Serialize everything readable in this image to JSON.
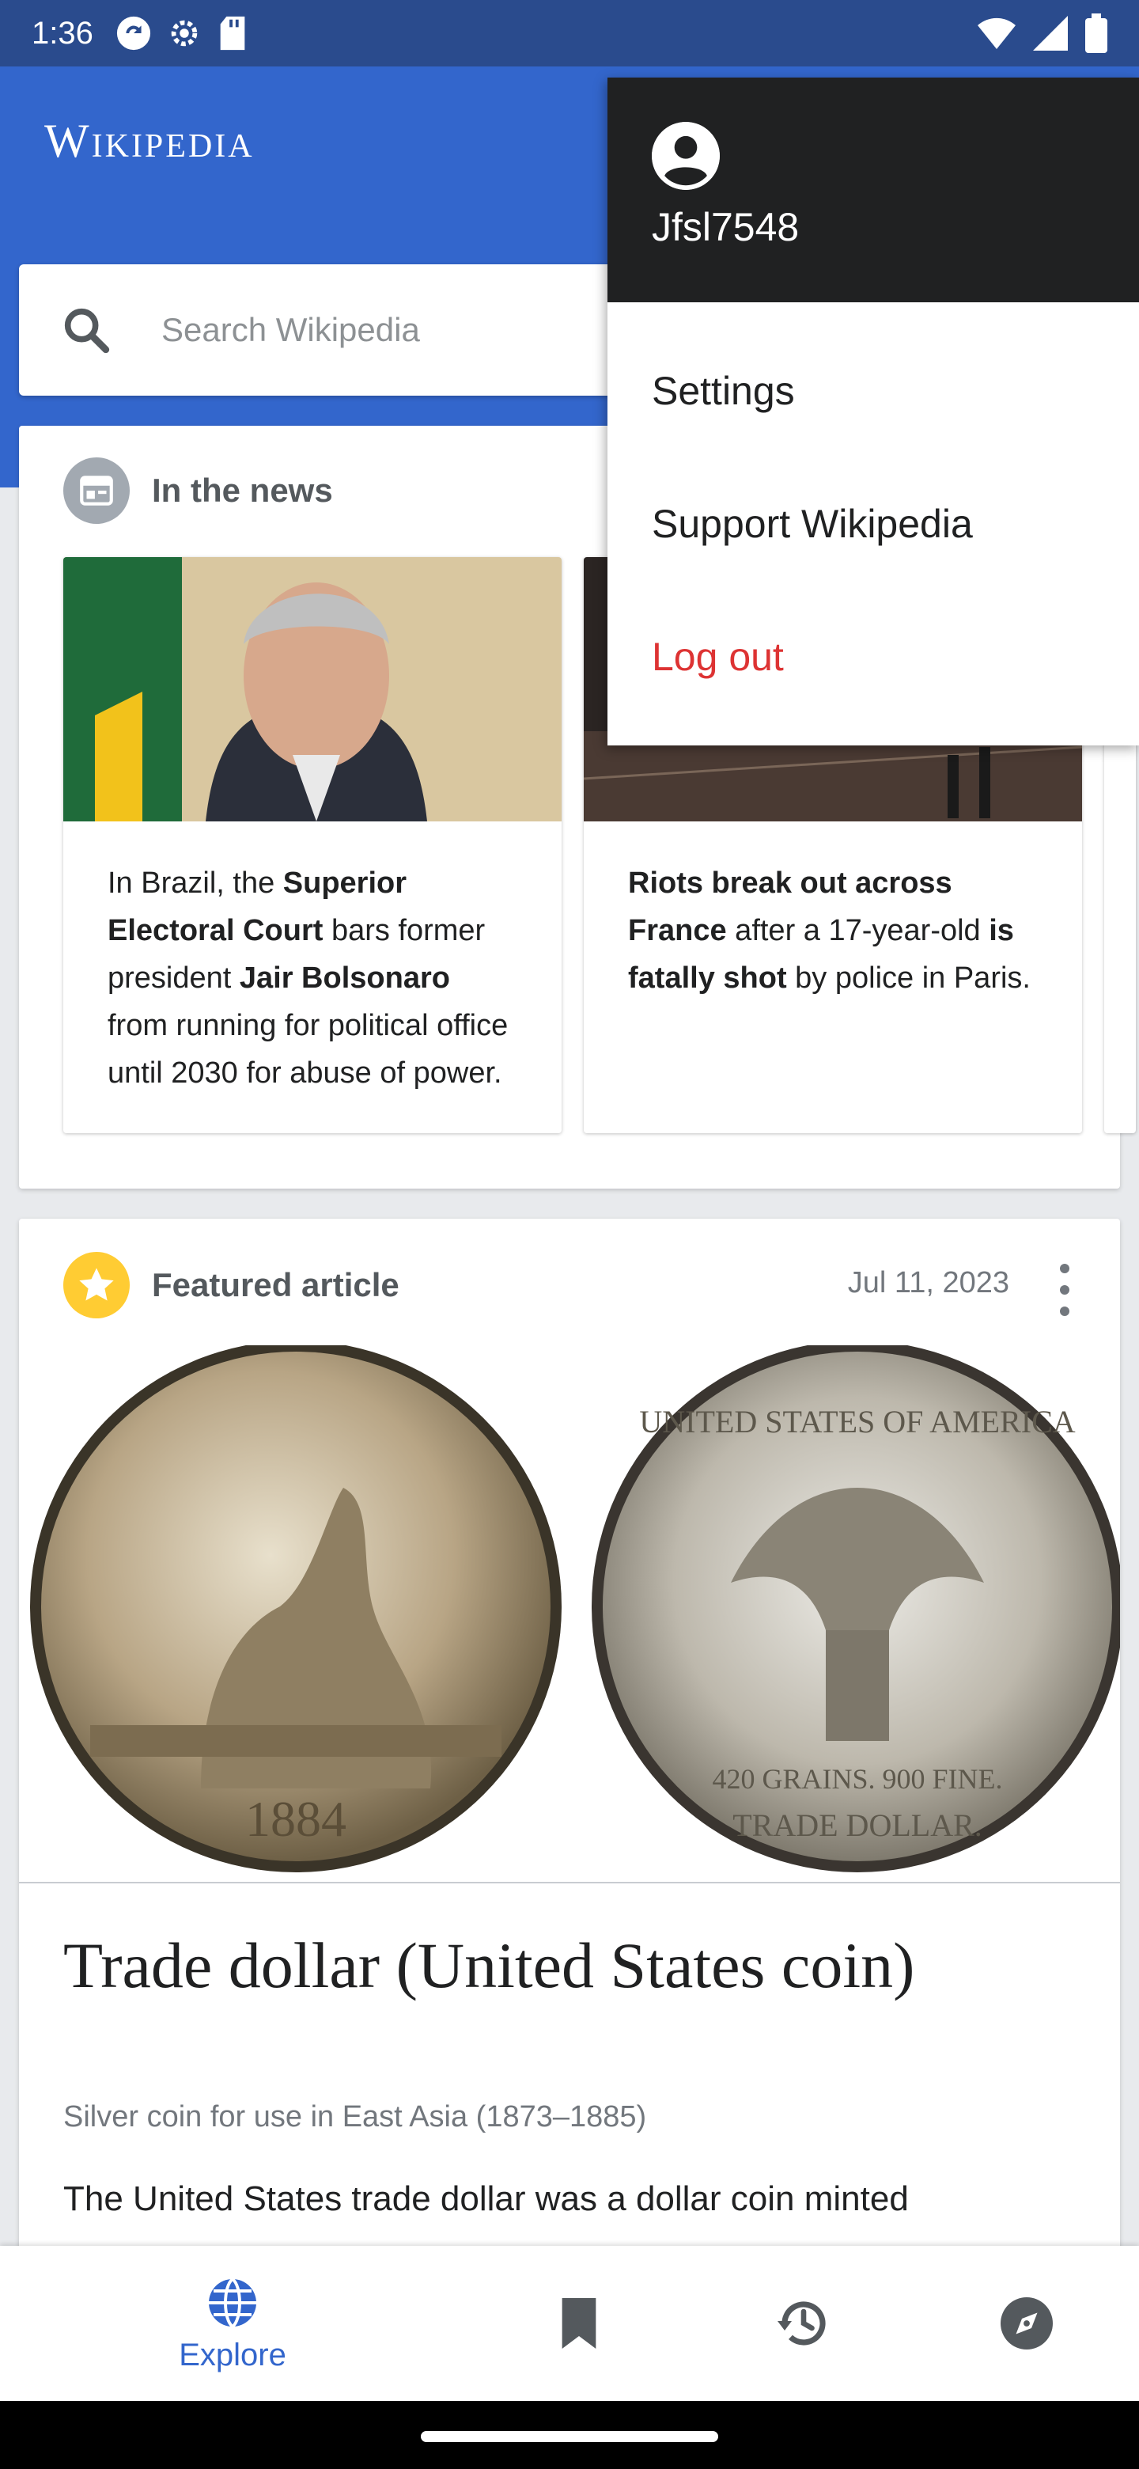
{
  "status_bar": {
    "time": "1:36",
    "icons_left": [
      "sync-icon",
      "settings-icon",
      "sd-card-icon"
    ],
    "icons_right": [
      "wifi-icon",
      "signal-icon",
      "battery-icon"
    ]
  },
  "app_bar": {
    "wordmark": "Wikipedia"
  },
  "search": {
    "placeholder": "Search Wikipedia"
  },
  "in_the_news": {
    "title": "In the news",
    "items": [
      {
        "text_parts": [
          {
            "t": "In Brazil, the ",
            "b": false
          },
          {
            "t": "Superior Electoral Court",
            "b": true
          },
          {
            "t": " bars former president ",
            "b": false
          },
          {
            "t": "Jair Bolsonaro",
            "b": true
          },
          {
            "t": " from running for political office until 2030 for abuse of power.",
            "b": false
          }
        ]
      },
      {
        "text_parts": [
          {
            "t": "Riots break out across France",
            "b": true
          },
          {
            "t": " after a 17-year-old ",
            "b": false
          },
          {
            "t": "is fatally shot",
            "b": true
          },
          {
            "t": " by police in Paris.",
            "b": false
          }
        ]
      }
    ]
  },
  "featured_article": {
    "header": "Featured article",
    "date": "Jul 11, 2023",
    "title": "Trade dollar (United States coin)",
    "subtitle": "Silver coin for use in East Asia (1873–1885)",
    "extract": "The United States trade dollar was a dollar coin minted",
    "coin_obverse_year": "1884",
    "coin_reverse_lines": [
      "UNITED STATES OF AMERICA",
      "420 GRAINS. 900 FINE.",
      "TRADE DOLLAR."
    ]
  },
  "bottom_nav": {
    "items": [
      {
        "label": "Explore",
        "icon": "globe-icon",
        "active": true
      },
      {
        "label": "",
        "icon": "bookmark-icon",
        "active": false
      },
      {
        "label": "",
        "icon": "history-icon",
        "active": false
      },
      {
        "label": "",
        "icon": "compass-icon",
        "active": false
      }
    ]
  },
  "overflow_menu": {
    "username": "Jfsl7548",
    "items": [
      {
        "label": "Settings"
      },
      {
        "label": "Support Wikipedia"
      },
      {
        "label": "Log out"
      }
    ]
  },
  "colors": {
    "app_bar": "#3366cc",
    "status_bar": "#2a4b8d",
    "menu_header": "#202122",
    "logout": "#dd3333",
    "featured_star": "#ffcc33"
  }
}
